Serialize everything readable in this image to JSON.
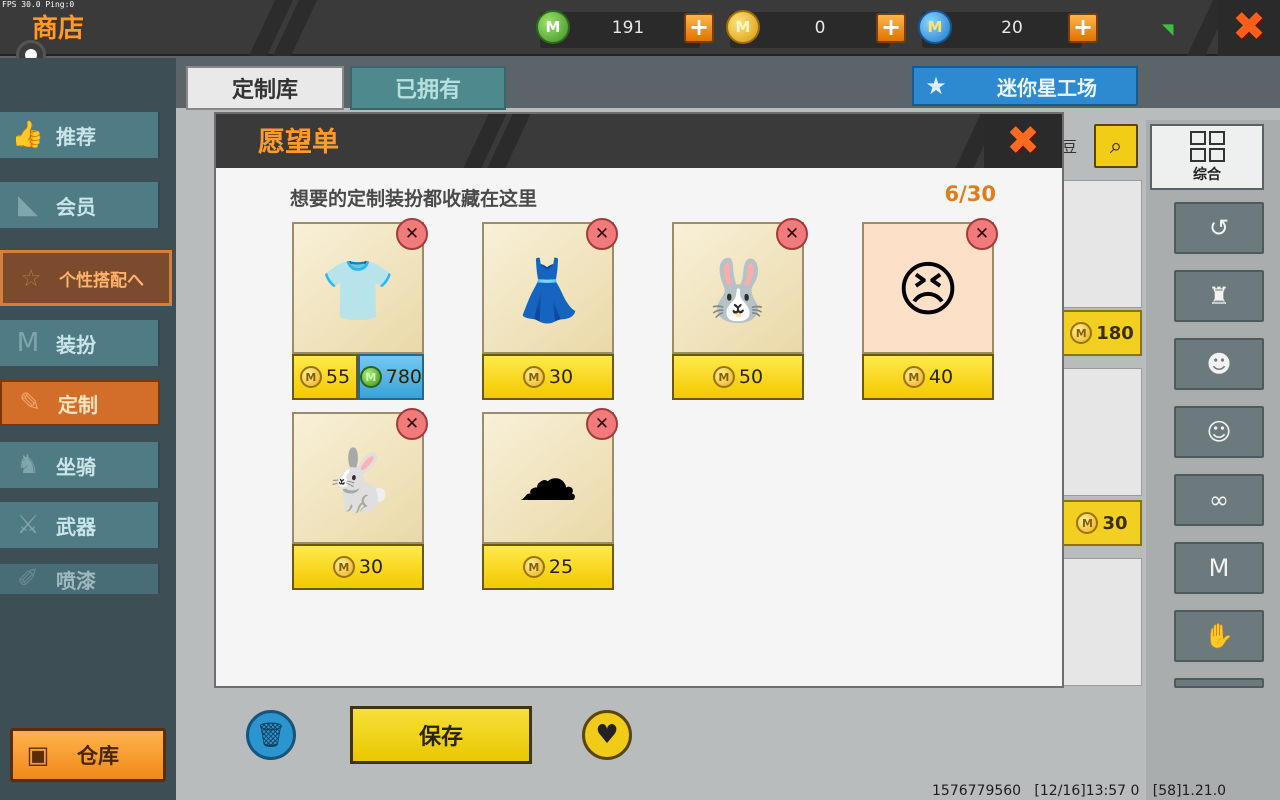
{
  "header": {
    "fps_text": "FPS 30.0  Ping:0",
    "title": "商店",
    "currencies": [
      {
        "name": "green-bean",
        "value": "191",
        "icon": "green-bean-icon"
      },
      {
        "name": "mini-coin",
        "value": "0",
        "icon": "mini-coin-icon"
      },
      {
        "name": "mini-star",
        "value": "20",
        "icon": "mini-star-icon"
      }
    ],
    "close_glyph": "✖"
  },
  "sidebar": {
    "items": [
      {
        "label": "推荐",
        "icon": "thumbs-up-icon"
      },
      {
        "label": "会员",
        "icon": "membership-icon"
      },
      {
        "label": "个性搭配へ",
        "icon": "personal-outfit-icon"
      },
      {
        "label": "装扮",
        "icon": "shirt-icon"
      },
      {
        "label": "定制",
        "icon": "pencil-icon"
      },
      {
        "label": "坐骑",
        "icon": "mount-icon"
      },
      {
        "label": "武器",
        "icon": "weapon-icon"
      },
      {
        "label": "喷漆",
        "icon": "spray-icon"
      }
    ],
    "warehouse_label": "仓库"
  },
  "tabs": {
    "custom_library": "定制库",
    "owned": "已拥有",
    "workshop": "迷你星工场"
  },
  "filters": {
    "all_label": "综合",
    "search_partial": "豆"
  },
  "background_prices": {
    "p1": "180",
    "p2": "30"
  },
  "bottom": {
    "save_label": "保存"
  },
  "footer": {
    "info": "1576779560   [12/16]13:57 0   [58]1.21.0"
  },
  "wishlist": {
    "title": "愿望单",
    "subtitle": "想要的定制装扮都收藏在这里",
    "count": "6/30",
    "items": [
      {
        "name": "grey-sweater-outfit",
        "price_coin": "55",
        "price_bean": "780"
      },
      {
        "name": "blue-skirt-outfit",
        "price_coin": "30"
      },
      {
        "name": "bunny-ear-hair",
        "price_coin": "50"
      },
      {
        "name": "pouting-face",
        "price_coin": "40"
      },
      {
        "name": "bunny-slippers",
        "price_coin": "30"
      },
      {
        "name": "cloud-rainbow-effect",
        "price_coin": "25"
      }
    ],
    "delete_glyph": "✕"
  },
  "colors": {
    "accent_orange": "#ff9b2a",
    "price_yellow": "#f3c900",
    "delete_red": "#f17a7a"
  }
}
